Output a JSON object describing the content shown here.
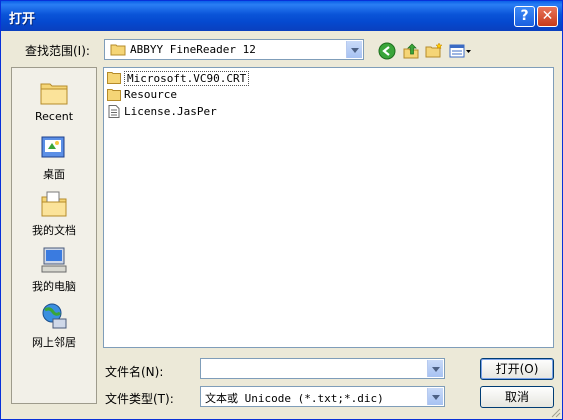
{
  "window": {
    "title": "打开",
    "help_glyph": "?",
    "close_glyph": "✕"
  },
  "lookin": {
    "label": "查找范围(I):",
    "value": "ABBYY FineReader 12"
  },
  "places": [
    {
      "label": "Recent",
      "icon": "recent-folder-icon"
    },
    {
      "label": "桌面",
      "icon": "desktop-icon"
    },
    {
      "label": "我的文档",
      "icon": "my-documents-icon"
    },
    {
      "label": "我的电脑",
      "icon": "my-computer-icon"
    },
    {
      "label": "网上邻居",
      "icon": "network-places-icon"
    }
  ],
  "files": [
    {
      "name": "Microsoft.VC90.CRT",
      "type": "folder"
    },
    {
      "name": "Resource",
      "type": "folder"
    },
    {
      "name": "License.JasPer",
      "type": "file"
    }
  ],
  "filename": {
    "label": "文件名(N):",
    "value": ""
  },
  "filetype": {
    "label": "文件类型(T):",
    "value": "文本或 Unicode (*.txt;*.dic)"
  },
  "buttons": {
    "open": "打开(O)",
    "cancel": "取消"
  },
  "colors": {
    "titlebar": "#0a54d8",
    "dialog_bg": "#ece9d8",
    "folder": "#f5d576"
  }
}
